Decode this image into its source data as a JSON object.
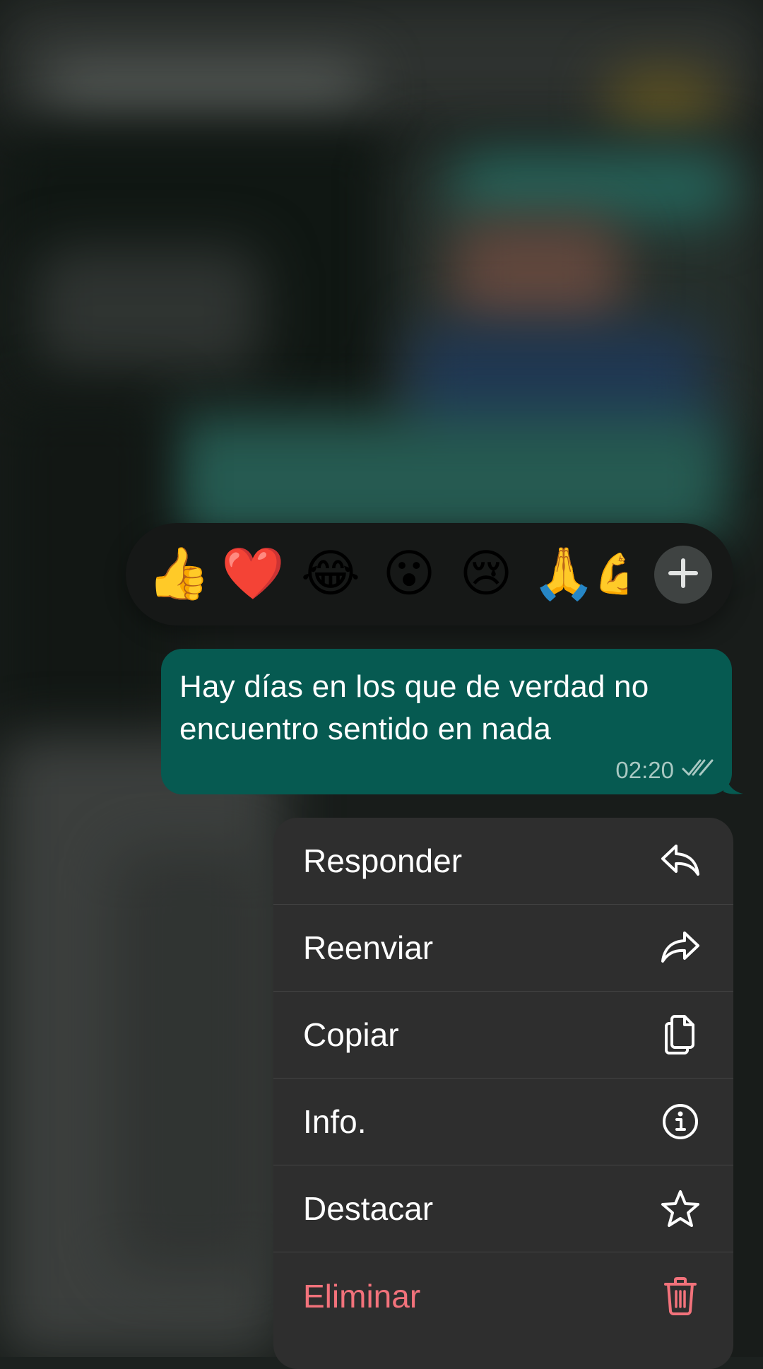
{
  "reactions": {
    "emojis": [
      {
        "name": "thumbs-up",
        "glyph": "👍"
      },
      {
        "name": "red-heart",
        "glyph": "❤️"
      },
      {
        "name": "tears-of-joy",
        "glyph": "😂"
      },
      {
        "name": "surprised",
        "glyph": "😮"
      },
      {
        "name": "crying",
        "glyph": "😢"
      },
      {
        "name": "folded-hands",
        "glyph": "🙏"
      },
      {
        "name": "flexed-biceps",
        "glyph": "💪"
      }
    ],
    "more_icon": "plus-icon"
  },
  "message": {
    "text": "Hay días en los que de verdad no encuentro sentido en nada",
    "time": "02:20",
    "status_icon": "double-check-icon"
  },
  "menu": {
    "items": [
      {
        "label": "Responder",
        "icon": "reply-icon"
      },
      {
        "label": "Reenviar",
        "icon": "forward-icon"
      },
      {
        "label": "Copiar",
        "icon": "copy-icon"
      },
      {
        "label": "Info.",
        "icon": "info-icon"
      },
      {
        "label": "Destacar",
        "icon": "star-icon"
      },
      {
        "label": "Eliminar",
        "icon": "trash-icon"
      }
    ]
  },
  "colors": {
    "bubble": "#065a51",
    "menu_background": "#2e2e2e",
    "danger": "#f2727b",
    "reaction_bar": "#161817"
  }
}
